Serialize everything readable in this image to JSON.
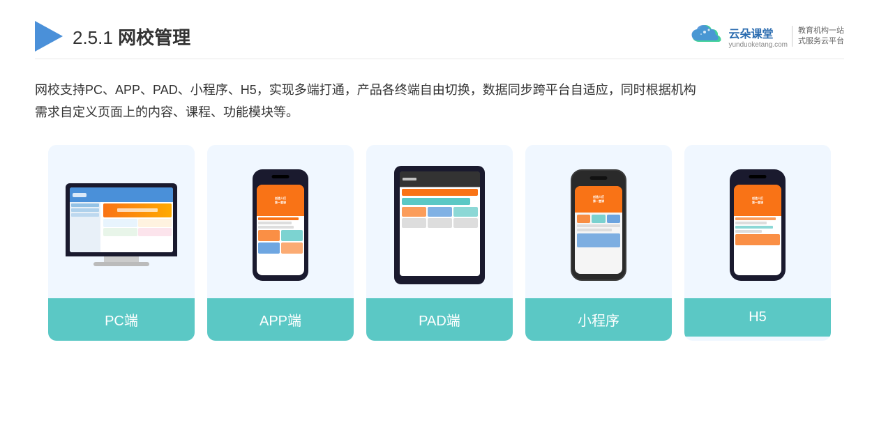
{
  "header": {
    "title_prefix": "2.5.1 ",
    "title_bold": "网校管理",
    "brand": {
      "name": "云朵课堂",
      "url": "yunduoketang.com",
      "tagline_line1": "教育机构一站",
      "tagline_line2": "式服务云平台"
    }
  },
  "description": {
    "line1": "网校支持PC、APP、PAD、小程序、H5，实现多端打通，产品各终端自由切换，数据同步跨平台自适应，同时根据机构",
    "line2": "需求自定义页面上的内容、课程、功能模块等。"
  },
  "cards": [
    {
      "id": "pc",
      "label": "PC端",
      "device_type": "pc"
    },
    {
      "id": "app",
      "label": "APP端",
      "device_type": "phone"
    },
    {
      "id": "pad",
      "label": "PAD端",
      "device_type": "tablet"
    },
    {
      "id": "miniprogram",
      "label": "小程序",
      "device_type": "phone2"
    },
    {
      "id": "h5",
      "label": "H5",
      "device_type": "phone3"
    }
  ],
  "colors": {
    "card_label_bg": "#5BC8C5",
    "card_bg": "#EDF5FF",
    "accent_orange": "#f97316",
    "accent_blue": "#4A90D9",
    "accent_teal": "#5BC8C5"
  }
}
